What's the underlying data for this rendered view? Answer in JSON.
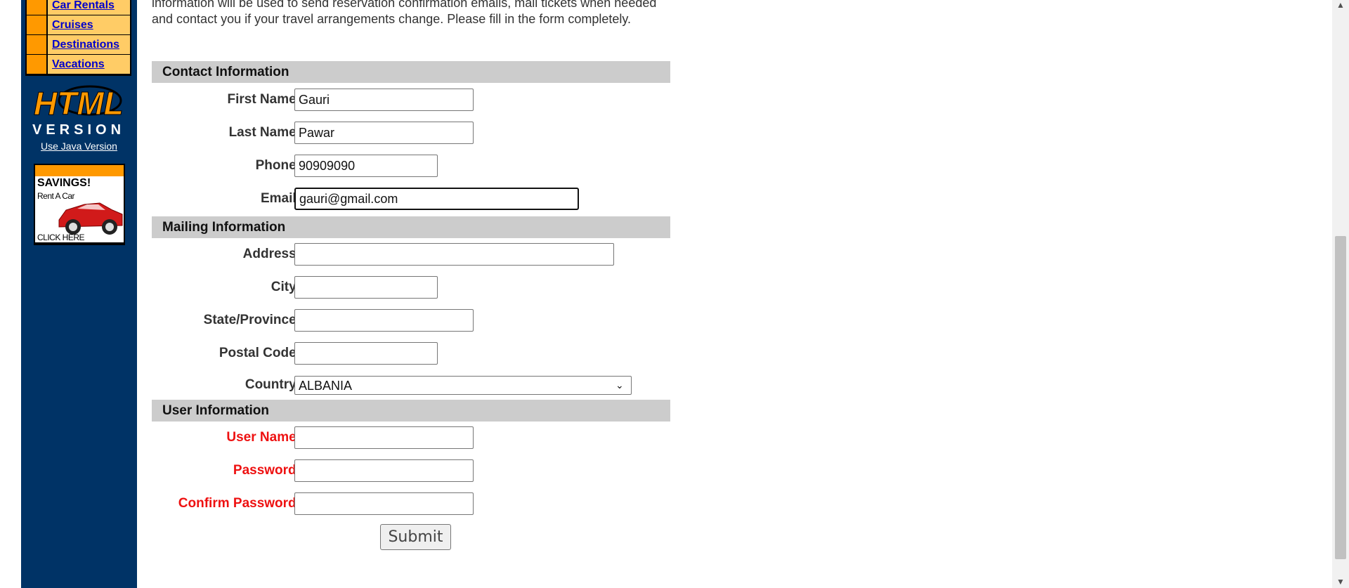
{
  "nav": {
    "links": [
      "Car Rentals",
      "Cruises",
      "Destinations",
      "Vacations"
    ],
    "html_version_line1": "HTML",
    "html_version_line2": "VERSION",
    "java_link": "Use Java Version",
    "ad": {
      "headline": "SAVINGS!",
      "sub": "Rent A Car",
      "cta": "CLICK HERE"
    }
  },
  "intro": "information will be used to send reservation confirmation emails, mail tickets when needed and contact you if your travel arrangements change. Please fill in the form completely.",
  "sections": {
    "contact": "Contact Information",
    "mailing": "Mailing Information",
    "user": "User Information"
  },
  "fields": {
    "first_name": {
      "label": "First Name:",
      "value": "Gauri"
    },
    "last_name": {
      "label": "Last Name:",
      "value": "Pawar"
    },
    "phone": {
      "label": "Phone:",
      "value": "90909090"
    },
    "email": {
      "label": "Email:",
      "value": "gauri@gmail.com"
    },
    "address": {
      "label": "Address:",
      "value": ""
    },
    "city": {
      "label": "City:",
      "value": ""
    },
    "state": {
      "label": "State/Province:",
      "value": ""
    },
    "postal": {
      "label": "Postal Code:",
      "value": ""
    },
    "country": {
      "label": "Country:",
      "value": "ALBANIA"
    },
    "username": {
      "label": "User Name:",
      "value": ""
    },
    "password": {
      "label": "Password:",
      "value": ""
    },
    "confirm": {
      "label": "Confirm Password:",
      "value": ""
    }
  },
  "submit_label": "Submit",
  "colors": {
    "nav_bg": "#003366",
    "nav_accent": "#ff9900",
    "nav_link_bg": "#ffcc66",
    "required": "#ee1111",
    "section_bg": "#cccccc"
  }
}
